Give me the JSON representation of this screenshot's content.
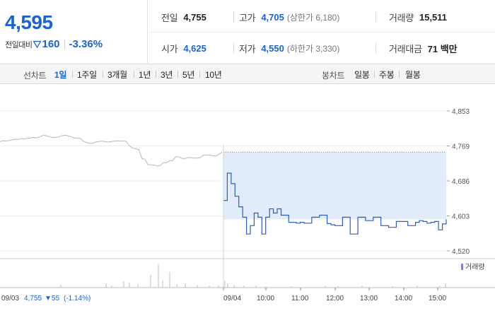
{
  "quote": {
    "price": "4,595",
    "change_label": "전일대비",
    "change_value": "160",
    "change_percent": "-3.36%"
  },
  "stats": {
    "prev_close": {
      "label": "전일",
      "value": "4,755"
    },
    "high": {
      "label": "고가",
      "value": "4,705",
      "limit_label": "(상한가 6,180)"
    },
    "volume": {
      "label": "거래량",
      "value": "15,511"
    },
    "open": {
      "label": "시가",
      "value": "4,625"
    },
    "low": {
      "label": "저가",
      "value": "4,550",
      "limit_label": "(하한가 3,330)"
    },
    "amount": {
      "label": "거래대금",
      "value": "71 백만"
    }
  },
  "toolbar": {
    "line_chart_label": "선차트",
    "periods": [
      "1일",
      "1주일",
      "3개월",
      "1년",
      "3년",
      "5년",
      "10년"
    ],
    "active_period": "1일",
    "candle_chart_label": "봉차트",
    "candles": [
      "일봉",
      "주봉",
      "월봉"
    ]
  },
  "colors": {
    "accent_blue": "#1b63d4",
    "prev_day_line": "#b7b7b7",
    "today_line": "#2c5fc2",
    "today_fill": "#e3ecfb"
  },
  "chart_data": {
    "type": "line",
    "y_ticks": [
      "4,853",
      "4,769",
      "4,686",
      "4,603",
      "4,520"
    ],
    "ylim": [
      4520,
      4853
    ],
    "reference_level": 4755,
    "volume_legend": "거래량",
    "prev_day_footer": {
      "date": "09/03",
      "close": "4,755",
      "change": "▼55",
      "change_pct": "(-1.14%)"
    },
    "x_ticks": [
      "09/04",
      "10:00",
      "11:00",
      "12:00",
      "13:00",
      "14:00",
      "15:00"
    ],
    "series": [
      {
        "session": "09/03",
        "values": [
          4780,
          4782,
          4781,
          4783,
          4784,
          4786,
          4785,
          4787,
          4786,
          4788,
          4789,
          4790,
          4789,
          4792,
          4795,
          4794,
          4792,
          4790,
          4790,
          4791,
          4794,
          4795,
          4794,
          4792,
          4789,
          4788,
          4788,
          4781,
          4778,
          4776,
          4776,
          4779,
          4780,
          4781,
          4780,
          4779,
          4780,
          4781,
          4782,
          4781,
          4782,
          4780,
          4770,
          4765,
          4763,
          4761,
          4740,
          4738,
          4725,
          4725,
          4724,
          4722,
          4723,
          4730,
          4730,
          4735,
          4735,
          4744,
          4744,
          4740,
          4740,
          4742,
          4742,
          4741,
          4741,
          4742,
          4748,
          4748,
          4748,
          4746,
          4746,
          4750,
          4755
        ]
      },
      {
        "session": "09/04",
        "values": [
          4640,
          4705,
          4680,
          4650,
          4625,
          4600,
          4560,
          4580,
          4610,
          4600,
          4560,
          4600,
          4620,
          4610,
          4620,
          4605,
          4605,
          4588,
          4588,
          4586,
          4588,
          4586,
          4586,
          4600,
          4600,
          4605,
          4605,
          4585,
          4582,
          4580,
          4580,
          4600,
          4600,
          4560,
          4560,
          4600,
          4600,
          4592,
          4592,
          4600,
          4600,
          4580,
          4580,
          4576,
          4576,
          4590,
          4590,
          4590,
          4580,
          4580,
          4588,
          4592,
          4590,
          4586,
          4588,
          4590,
          4570,
          4584,
          4595
        ]
      }
    ]
  }
}
